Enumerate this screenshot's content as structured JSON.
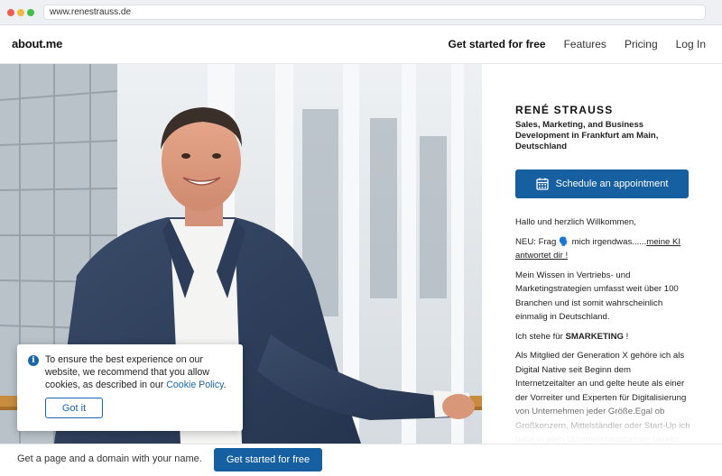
{
  "browser": {
    "url": "www.renestrauss.de"
  },
  "header": {
    "logo": "about.me",
    "nav": [
      {
        "label": "Get started for free"
      },
      {
        "label": "Features"
      },
      {
        "label": "Pricing"
      },
      {
        "label": "Log In"
      }
    ]
  },
  "profile": {
    "name": "RENÉ STRAUSS",
    "headline": "Sales, Marketing, and Business Development in Frankfurt am Main, Deutschland",
    "appointment_button": "Schedule an appointment",
    "bio": {
      "greeting": "Hallo und herzlich Willkommen,",
      "ki_prefix": "NEU: Frag 🗣️ mich irgendwas......",
      "ki_link": "meine KI antwortet dir !",
      "wissen": "Mein Wissen in Vertriebs- und Marketingstrategien umfasst weit über 100 Branchen und ist somit wahrscheinlich einmalig in Deutschland.",
      "smarketing_prefix": "Ich stehe für ",
      "smarketing_bold": "SMARKETING",
      "smarketing_suffix": " !",
      "generation": "Als Mitglied der Generation X gehöre ich als Digital Native seit Beginn dem Internetzeitalter an und gelte heute als einer der Vorreiter und Experten für Digitalisierung von Unternehmen jeder Größe.Egal ob Großkonzern, Mittelständler oder Start-Up ich habe in allen Unternehmensformen bereits erfolgreich gearbeitet"
    }
  },
  "cookie_notice": {
    "text": "To ensure the best experience on our website, we recommend that you allow cookies, as described in our ",
    "link": "Cookie Policy",
    "period": ".",
    "button": "Got it"
  },
  "bottom_bar": {
    "text": "Get a page and a domain with your name.",
    "button": "Get started for free"
  },
  "colors": {
    "brand_blue": "#165fa0",
    "link_blue": "#1a66a8"
  }
}
